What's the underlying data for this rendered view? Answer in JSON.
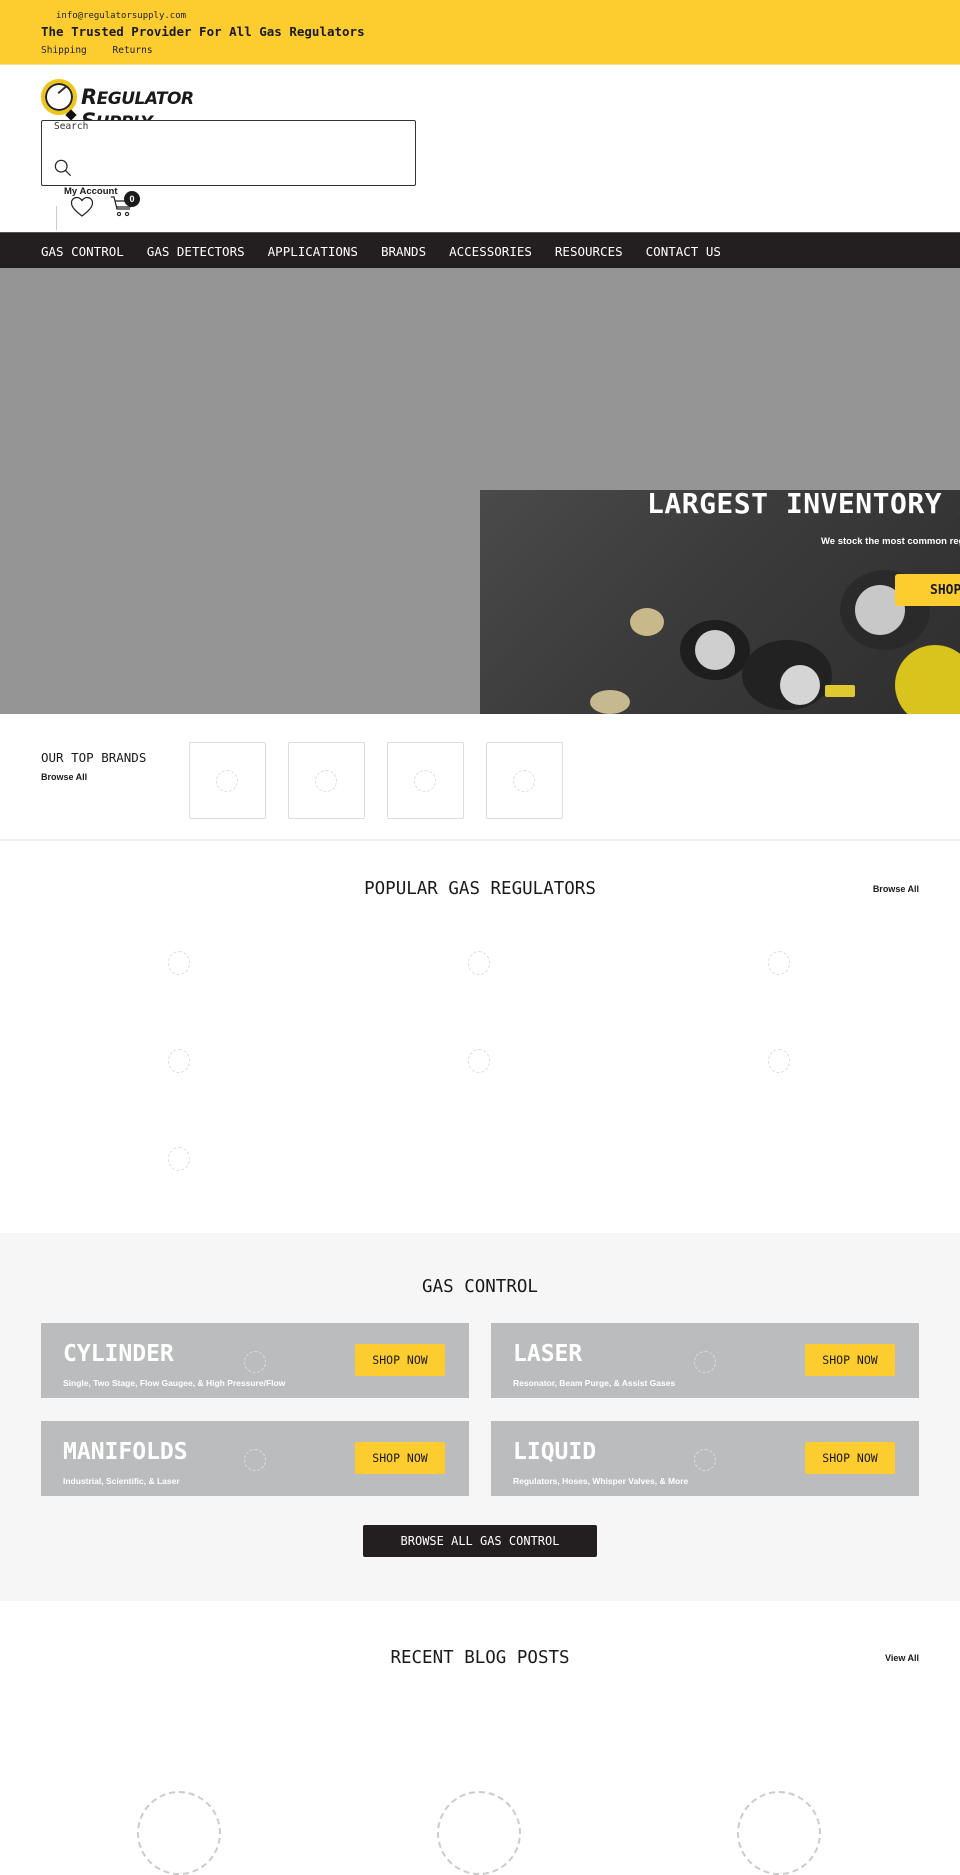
{
  "topbar": {
    "email": "info@regulatorsupply.com",
    "tagline": "The Trusted Provider For All Gas Regulators",
    "links": [
      "Shipping",
      "Returns"
    ]
  },
  "header": {
    "logo_text_1": "R",
    "logo_text_2": "EGULATOR ",
    "logo_text_3": "S",
    "logo_text_4": "UPPLY",
    "logo_alt": "Regulator Supply",
    "search_label": "Search",
    "search_value": "",
    "account_label": "My Account",
    "cart_count": "0",
    "icons": {
      "search": "search-icon",
      "wishlist": "heart-icon",
      "cart": "cart-icon"
    }
  },
  "nav": {
    "items": [
      "GAS CONTROL",
      "GAS DETECTORS",
      "APPLICATIONS",
      "BRANDS",
      "ACCESSORIES",
      "RESOURCES",
      "CONTACT US"
    ]
  },
  "hero": {
    "title": "LARGEST INVENTORY A",
    "subtitle": "We stock the most common regu",
    "button": "SHOP"
  },
  "top_brands": {
    "title": "OUR TOP BRANDS",
    "browse": "Browse All",
    "tile_count": 4
  },
  "popular": {
    "title": "POPULAR GAS REGULATORS",
    "browse": "Browse All"
  },
  "gas_control": {
    "title": "GAS CONTROL",
    "cards": [
      {
        "name": "CYLINDER",
        "desc": "Single, Two Stage, Flow Gaugee, & High Pressure/Flow",
        "button": "SHOP NOW"
      },
      {
        "name": "LASER",
        "desc": "Resonator, Beam Purge, & Assist Gases",
        "button": "SHOP NOW"
      },
      {
        "name": "MANIFOLDS",
        "desc": "Industrial, Scientific, & Laser",
        "button": "SHOP NOW"
      },
      {
        "name": "LIQUID",
        "desc": "Regulators, Hoses, Whisper Valves, & More",
        "button": "SHOP NOW"
      }
    ],
    "browse_all": "BROWSE ALL GAS CONTROL"
  },
  "blog": {
    "title": "RECENT BLOG POSTS",
    "view_all": "View All"
  },
  "colors": {
    "accent_yellow": "#fdcd30",
    "nav_dark": "#231f20",
    "card_gray": "#bbbcbd",
    "hero_gray": "#959595",
    "section_bg": "#f6f6f6"
  }
}
